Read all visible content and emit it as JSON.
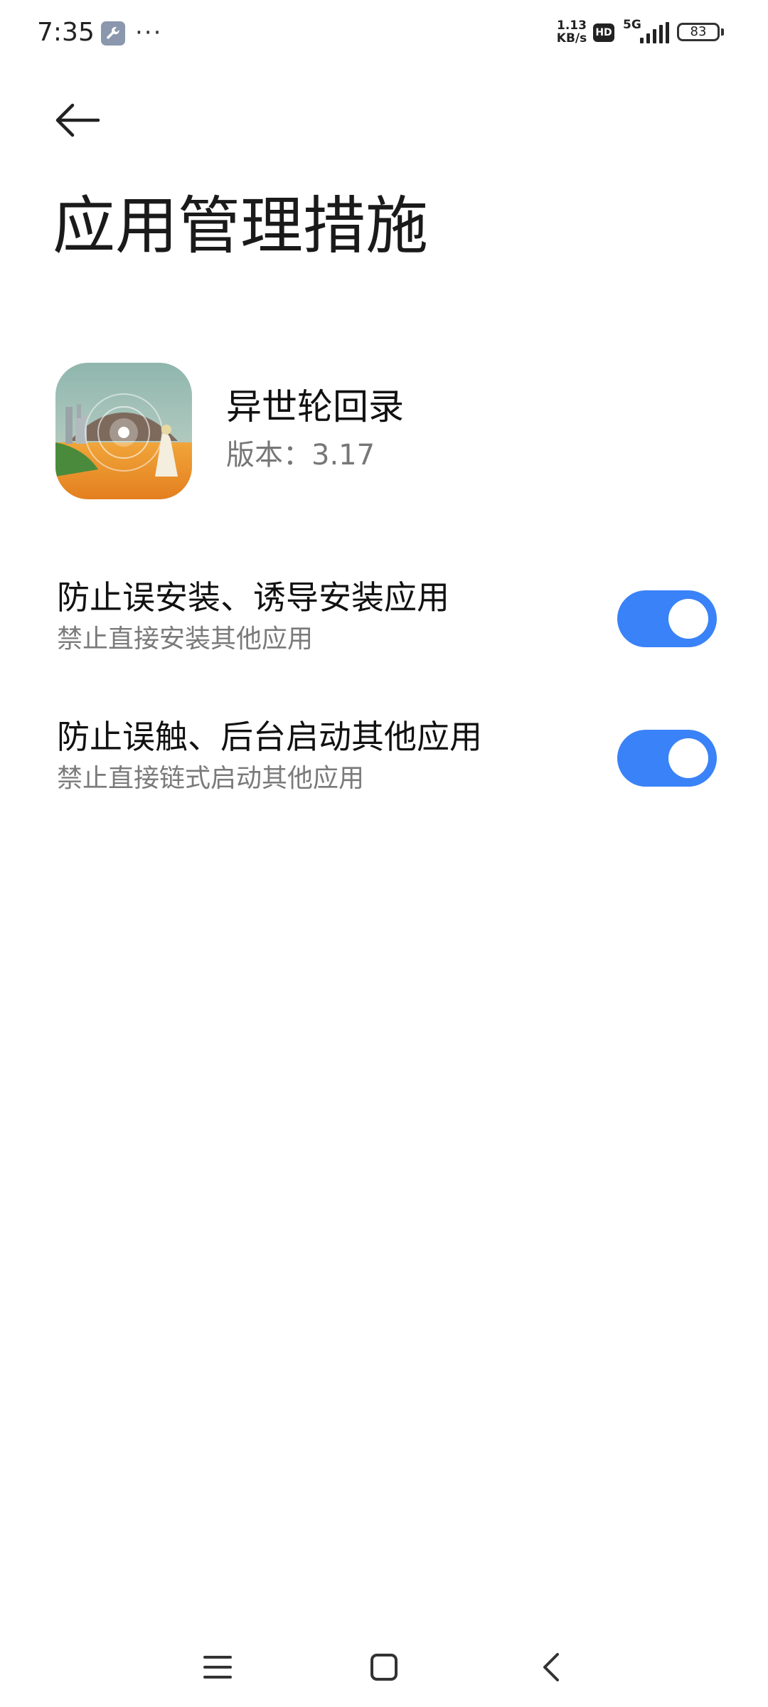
{
  "status_bar": {
    "time": "7:35",
    "more_indicator": "···",
    "net_speed_value": "1.13",
    "net_speed_unit": "KB/s",
    "hd_label": "HD",
    "network_type": "5G",
    "battery_level": "83",
    "icons": [
      "wrench-icon",
      "signal-icon",
      "battery-icon"
    ]
  },
  "header": {
    "back_icon": "arrow-left-icon",
    "title": "应用管理措施"
  },
  "app": {
    "name": "异世轮回录",
    "version": "版本：3.17"
  },
  "settings": [
    {
      "title": "防止误安装、诱导安装应用",
      "subtitle": "禁止直接安装其他应用",
      "enabled": true
    },
    {
      "title": "防止误触、后台启动其他应用",
      "subtitle": "禁止直接链式启动其他应用",
      "enabled": true
    }
  ],
  "nav_bar": {
    "icons": [
      "menu-icon",
      "home-square-icon",
      "back-chevron-icon"
    ]
  },
  "colors": {
    "toggle_on": "#3a82f7",
    "text_primary": "#111111",
    "text_secondary": "#7a7a7a"
  }
}
